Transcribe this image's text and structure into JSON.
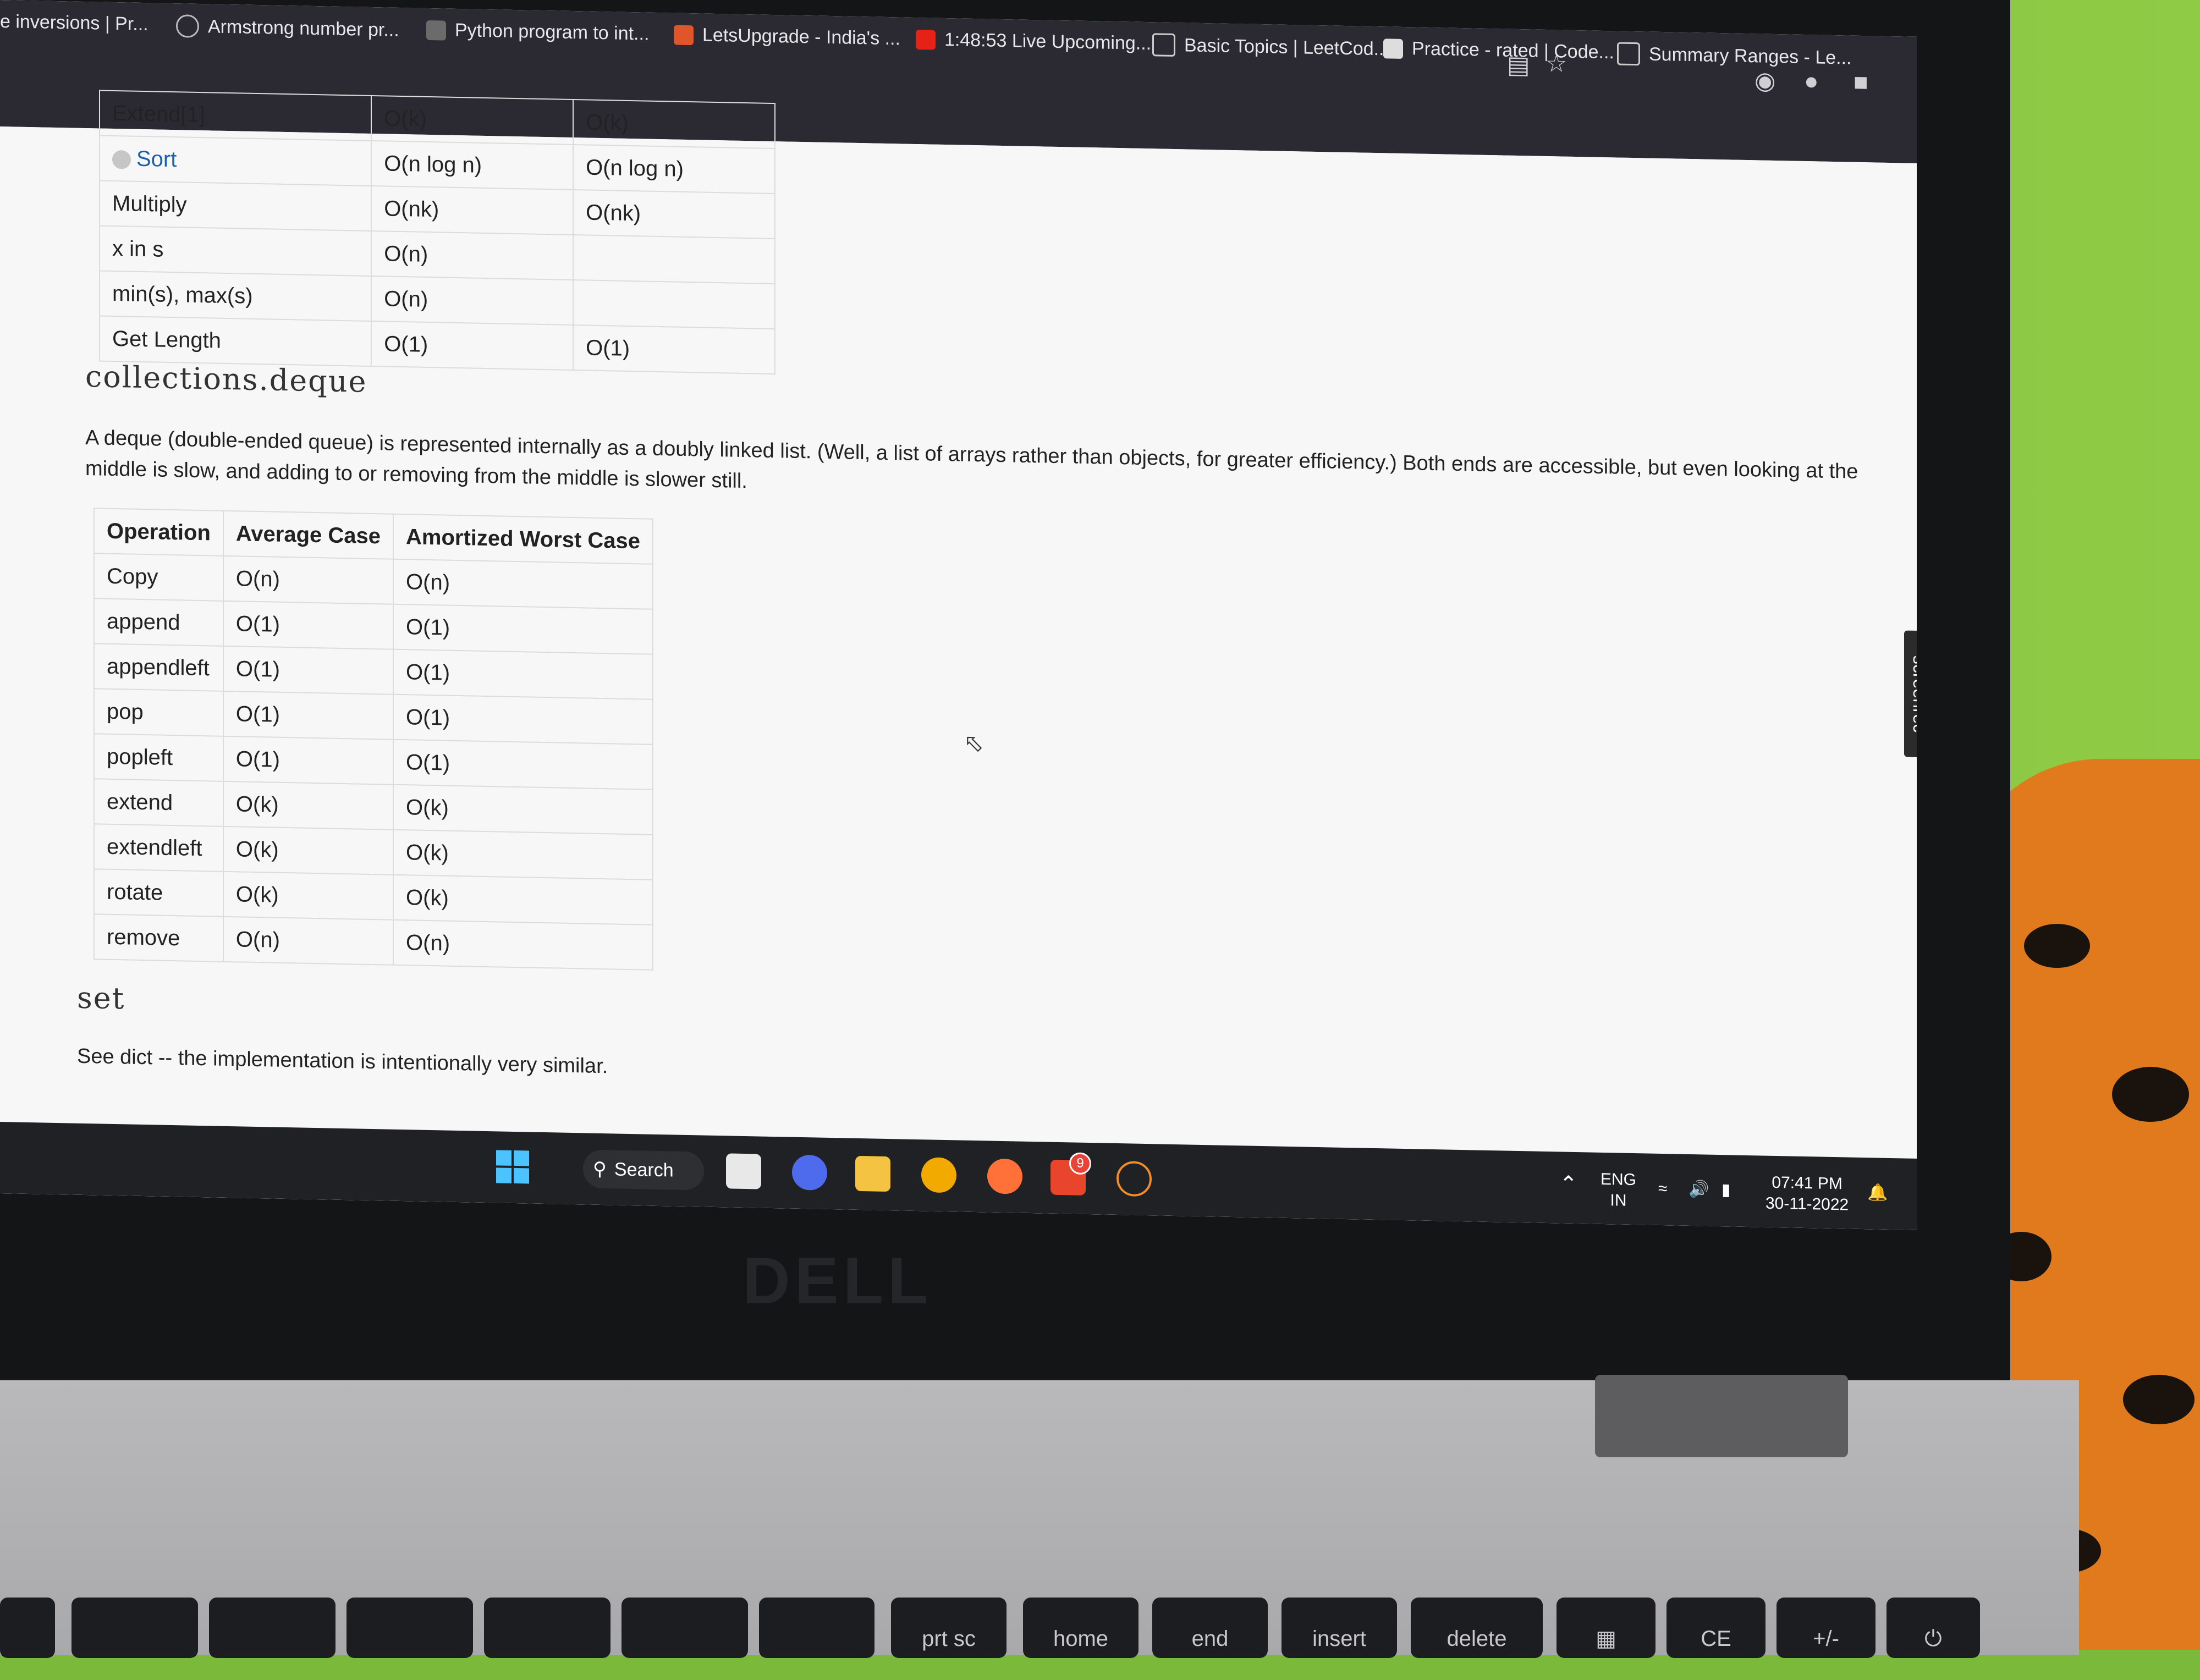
{
  "bookmarks": [
    {
      "label": "e inversions | Pr...",
      "icon": "globe-icon"
    },
    {
      "label": "Armstrong number pr...",
      "icon": "globe-icon"
    },
    {
      "label": "Python program to int...",
      "icon": "site-icon"
    },
    {
      "label": "LetsUpgrade - India's ...",
      "icon": "letsupgrade-icon"
    },
    {
      "label": "1:48:53 Live Upcoming...",
      "icon": "youtube-icon"
    },
    {
      "label": "Basic Topics | LeetCod...",
      "icon": "leetcode-icon"
    },
    {
      "label": "Practice - rated | Code...",
      "icon": "codechef-icon"
    },
    {
      "label": "Summary Ranges - Le...",
      "icon": "leetcode-icon"
    }
  ],
  "list_table": {
    "rows": [
      {
        "op": "Extend[1]",
        "avg": "O(k)",
        "worst": "O(k)"
      },
      {
        "op": "Sort",
        "avg": "O(n log n)",
        "worst": "O(n log n)"
      },
      {
        "op": "Multiply",
        "avg": "O(nk)",
        "worst": "O(nk)"
      },
      {
        "op": "x in s",
        "avg": "O(n)",
        "worst": ""
      },
      {
        "op": "min(s), max(s)",
        "avg": "O(n)",
        "worst": ""
      },
      {
        "op": "Get Length",
        "avg": "O(1)",
        "worst": "O(1)"
      }
    ]
  },
  "deque_section": {
    "heading": "collections.deque",
    "paragraph": "A deque (double-ended queue) is represented internally as a doubly linked list. (Well, a list of arrays rather than objects, for greater efficiency.) Both ends are accessible, but even looking at the middle is slow, and adding to or removing from the middle is slower still.",
    "headers": [
      "Operation",
      "Average Case",
      "Amortized Worst Case"
    ],
    "rows": [
      {
        "op": "Copy",
        "avg": "O(n)",
        "worst": "O(n)"
      },
      {
        "op": "append",
        "avg": "O(1)",
        "worst": "O(1)"
      },
      {
        "op": "appendleft",
        "avg": "O(1)",
        "worst": "O(1)"
      },
      {
        "op": "pop",
        "avg": "O(1)",
        "worst": "O(1)"
      },
      {
        "op": "popleft",
        "avg": "O(1)",
        "worst": "O(1)"
      },
      {
        "op": "extend",
        "avg": "O(k)",
        "worst": "O(k)"
      },
      {
        "op": "extendleft",
        "avg": "O(k)",
        "worst": "O(k)"
      },
      {
        "op": "rotate",
        "avg": "O(k)",
        "worst": "O(k)"
      },
      {
        "op": "remove",
        "avg": "O(n)",
        "worst": "O(n)"
      }
    ]
  },
  "set_section": {
    "heading": "set",
    "paragraph": "See dict -- the implementation is intentionally very similar."
  },
  "screenrec_label": "screenrec",
  "taskbar": {
    "search_label": "Search",
    "mail_badge": "9",
    "lang": "ENG",
    "region": "IN",
    "time": "07:41 PM",
    "date": "30-11-2022"
  },
  "keys": [
    "prt sc",
    "home",
    "end",
    "insert",
    "delete",
    "CE",
    "+/-"
  ],
  "colors": {
    "accent_link": "#1a5fb4",
    "taskbar": "#202124",
    "bookmark_bar": "#2b2a33"
  }
}
